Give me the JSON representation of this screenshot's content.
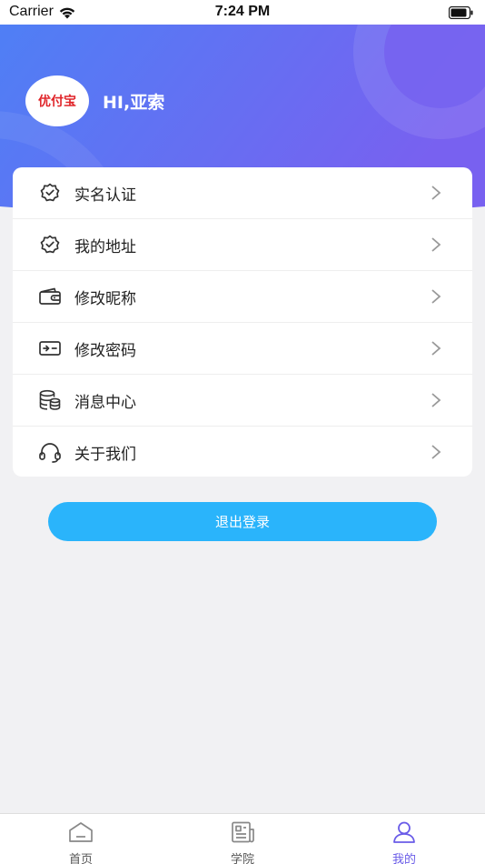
{
  "status_bar": {
    "carrier": "Carrier",
    "time": "7:24 PM"
  },
  "header": {
    "avatar_text": "优付宝",
    "greeting": "HI,亚索",
    "gradient_start": "#4f7ff5",
    "gradient_end": "#7861f0"
  },
  "menu": {
    "items": [
      {
        "label": "实名认证",
        "icon": "verified-badge-icon"
      },
      {
        "label": "我的地址",
        "icon": "address-badge-icon"
      },
      {
        "label": "修改昵称",
        "icon": "wallet-icon"
      },
      {
        "label": "修改密码",
        "icon": "password-card-icon"
      },
      {
        "label": "消息中心",
        "icon": "database-icon"
      },
      {
        "label": "关于我们",
        "icon": "headset-icon"
      }
    ]
  },
  "logout": {
    "label": "退出登录",
    "color": "#2ab4fb"
  },
  "tabbar": {
    "tabs": [
      {
        "label": "首页",
        "icon": "home-icon"
      },
      {
        "label": "学院",
        "icon": "news-icon"
      },
      {
        "label": "我的",
        "icon": "user-icon"
      }
    ],
    "active_color": "#6a5ce8"
  }
}
